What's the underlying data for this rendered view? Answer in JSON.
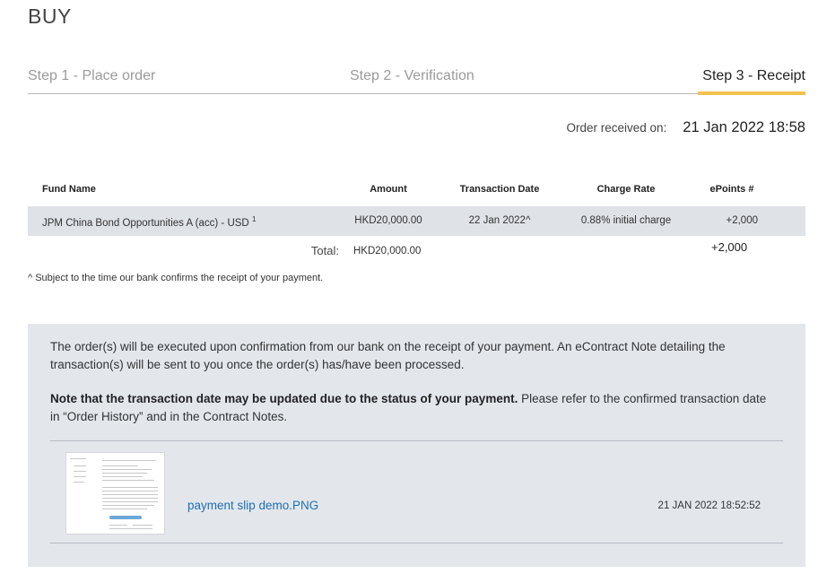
{
  "page": {
    "title": "BUY"
  },
  "steps": [
    {
      "label": "Step 1 - Place order"
    },
    {
      "label": "Step 2 - Verification"
    },
    {
      "label": "Step 3 - Receipt"
    }
  ],
  "order": {
    "received_label": "Order received on:",
    "received_value": "21 Jan 2022 18:58"
  },
  "table": {
    "headers": {
      "fund": "Fund Name",
      "amount": "Amount",
      "date": "Transaction Date",
      "rate": "Charge Rate",
      "points": "ePoints #"
    },
    "rows": [
      {
        "fund": "JPM China Bond Opportunities A (acc) - USD",
        "fund_sup": "1",
        "amount": "HKD20,000.00",
        "date": "22 Jan 2022^",
        "rate": "0.88% initial charge",
        "points": "+2,000"
      }
    ],
    "total": {
      "label": "Total:",
      "amount": "HKD20,000.00",
      "points": "+2,000"
    }
  },
  "footnote": "^ Subject to the time our bank confirms the receipt of your payment.",
  "info": {
    "p1": "The order(s) will be executed upon confirmation from our bank on the receipt of your payment. An eContract Note detailing the transaction(s) will be sent to you once the order(s) has/have been processed.",
    "p2_bold": "Note that the transaction date may be updated due to the status of your payment.",
    "p2_rest": " Please refer to the confirmed transaction date in “Order History” and in the Contract Notes."
  },
  "attachment": {
    "filename": "payment slip demo.PNG",
    "timestamp": "21 JAN 2022 18:52:52",
    "icon": "image-thumbnail"
  },
  "colors": {
    "active_step_accent": "#f2c14e",
    "link": "#1f6fb2",
    "panel_bg": "#e3e7ec",
    "row_bg": "#dfe2e6"
  }
}
